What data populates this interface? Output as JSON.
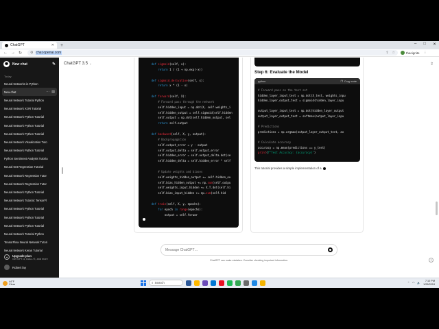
{
  "browser": {
    "tab_title": "ChatGPT",
    "new_tab": "+",
    "url": "chat.openai.com",
    "profile_name": "theoignite",
    "window_controls": [
      "–",
      "□",
      "✕"
    ]
  },
  "sidebar": {
    "new_chat": "New chat",
    "section": "Today",
    "items": [
      "Neural Networks in Python",
      "New chat",
      "Neural Network Tutorial Python",
      "Neural Network XOR Tutorial",
      "Neural Network Python Tutorial",
      "Neural Network Python Tutorial",
      "Neural Network Python Tutorial",
      "Neural Network Visualization Tuto",
      "Neural Network Python Tutorial",
      "Python Sentiment Analysis Tutoria",
      "Neural Net Regression Tutorial",
      "Neural Network Regression Tutor",
      "Neural Network Regression Tutor",
      "Neural Network Python Tutorial",
      "Neural Network Tutorial: TensorFl",
      "Neural Network Python Tutorial",
      "Neural Network Python Tutorial",
      "Neural Network Python Tutorial",
      "Neural Network Tutorial Python",
      "TensorFlow Neural Network Tutori",
      "Neural Network Keras Tutorial"
    ],
    "active_index": 1,
    "upgrade_title": "Upgrade plan",
    "upgrade_sub": "Get GPT-4, DALL·E, and more",
    "user_name": "Robert lay"
  },
  "header": {
    "model": "ChatGPT 3.5",
    "chevron": "⌄"
  },
  "left_code": [
    [
      [
        "    "
      ],
      [
        "def ",
        "kw"
      ],
      [
        "sigmoid",
        "fn"
      ],
      [
        "(self, x):"
      ]
    ],
    [
      [
        "        "
      ],
      [
        "return ",
        "kw"
      ],
      [
        "1 / (1 + np.exp(-x))"
      ]
    ],
    [
      [
        ""
      ]
    ],
    [
      [
        "    "
      ],
      [
        "def ",
        "kw"
      ],
      [
        "sigmoid_derivative",
        "fn"
      ],
      [
        "(self, x):"
      ]
    ],
    [
      [
        "        "
      ],
      [
        "return ",
        "kw"
      ],
      [
        "x * (1 - x)"
      ]
    ],
    [
      [
        ""
      ]
    ],
    [
      [
        "    "
      ],
      [
        "def ",
        "kw"
      ],
      [
        "forward",
        "fn"
      ],
      [
        "(self, X):"
      ]
    ],
    [
      [
        "        "
      ],
      [
        "# Forward pass through the network",
        "cm"
      ]
    ],
    [
      [
        "        self.hidden_input = np.dot(X, self.weights_i"
      ]
    ],
    [
      [
        "        self.hidden_output = self.sigmoid(self.hidden"
      ]
    ],
    [
      [
        "        self.output = np.dot(self.hidden_output, sel"
      ]
    ],
    [
      [
        "        "
      ],
      [
        "return ",
        "kw"
      ],
      [
        "self.output"
      ]
    ],
    [
      [
        ""
      ]
    ],
    [
      [
        "    "
      ],
      [
        "def ",
        "kw"
      ],
      [
        "backward",
        "fn"
      ],
      [
        "(self, X, y, output):"
      ]
    ],
    [
      [
        "        "
      ],
      [
        "# Backpropagation",
        "cm"
      ]
    ],
    [
      [
        "        self.output_error = y - output"
      ]
    ],
    [
      [
        "        self.output_delta = self.output_error"
      ]
    ],
    [
      [
        "        self.hidden_error = self.output_delta.dot(se"
      ]
    ],
    [
      [
        "        self.hidden_delta = self.hidden_error * self"
      ]
    ],
    [
      [
        ""
      ]
    ],
    [
      [
        "        "
      ],
      [
        "# Update weights and biases",
        "cm"
      ]
    ],
    [
      [
        "        self.weights_hidden_output += self.hidden_ou"
      ]
    ],
    [
      [
        "        self.bias_hidden_output += np."
      ],
      [
        "sum",
        "fn"
      ],
      [
        "(self.outpu"
      ]
    ],
    [
      [
        "        self.weights_input_hidden += X.T.dot(self.hi"
      ]
    ],
    [
      [
        "        self.bias_input_hidden += np."
      ],
      [
        "sum",
        "fn"
      ],
      [
        "(self.hid"
      ]
    ],
    [
      [
        ""
      ]
    ],
    [
      [
        "    "
      ],
      [
        "def ",
        "kw"
      ],
      [
        "train",
        "fn"
      ],
      [
        "(self, X, y, epochs):"
      ]
    ],
    [
      [
        "        "
      ],
      [
        "for ",
        "kw"
      ],
      [
        "epoch "
      ],
      [
        "in ",
        "kw"
      ],
      [
        "range",
        "fn"
      ],
      [
        "(epochs):"
      ]
    ],
    [
      [
        "            output = self.forwar"
      ]
    ]
  ],
  "right_pane": {
    "heading": "Step 6: Evaluate the Model",
    "code_lang": "python",
    "copy_label": "Copy code",
    "code": [
      [
        [
          "# Forward pass on the test set",
          "cm"
        ]
      ],
      [
        [
          "hidden_layer_input_test = np.dot(X_test, weights_inpu"
        ]
      ],
      [
        [
          "hidden_layer_output_test = sigmoid(hidden_layer_inpu"
        ]
      ],
      [
        [
          ""
        ]
      ],
      [
        [
          "output_layer_input_test = np.dot(hidden_layer_output"
        ]
      ],
      [
        [
          "output_layer_output_test = softmax(output_layer_inpu"
        ]
      ],
      [
        [
          ""
        ]
      ],
      [
        [
          "# Predictions",
          "cm"
        ]
      ],
      [
        [
          "predictions = np.argmax(output_layer_output_test, ax"
        ]
      ],
      [
        [
          ""
        ]
      ],
      [
        [
          "# Calculate accuracy",
          "cm"
        ]
      ],
      [
        [
          "accuracy = np.mean(predictions == y_test)"
        ]
      ],
      [
        [
          "print",
          "fn"
        ],
        [
          "("
        ],
        [
          "f\"Test Accuracy: {accuracy}\"",
          "st"
        ],
        [
          ")"
        ]
      ]
    ],
    "tutorial_text": "This tutorial provides a simple implementation of a"
  },
  "composer": {
    "placeholder": "Message ChatGPT…",
    "disclaimer": "ChatGPT can make mistakes. Consider checking important information.",
    "help": "?"
  },
  "taskbar": {
    "weather_temp": "44°F",
    "weather_desc": "Clear",
    "search_label": "Search",
    "time": "7:10 PM",
    "date": "1/28/2024",
    "icon_colors": [
      "#2b5797",
      "#ffb900",
      "#6b4bb8",
      "#0078d4",
      "#e81123",
      "#1db954",
      "#34a853",
      "#6b6b6b",
      "#1e88e5",
      "#f4b400"
    ]
  }
}
